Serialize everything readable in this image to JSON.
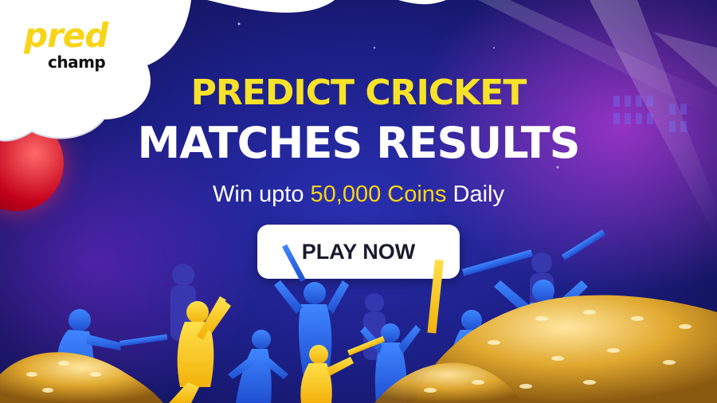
{
  "brand": {
    "logo_primary": "pred",
    "logo_secondary": "champ"
  },
  "hero": {
    "headline_line1": "PREDICT CRICKET",
    "headline_line2": "MATCHES RESULTS",
    "sub_prefix": "Win upto ",
    "sub_highlight": "50,000 Coins",
    "sub_suffix": " Daily"
  },
  "cta": {
    "label": "PLAY NOW"
  },
  "colors": {
    "accent_yellow": "#f7d416",
    "background_blue": "#1c1f86",
    "ball_red": "#c4001a",
    "coins_gold": "#e0a82e"
  },
  "icons": [
    "cricket-ball-icon",
    "batsman-silhouette-icon",
    "coin-pile-icon"
  ]
}
